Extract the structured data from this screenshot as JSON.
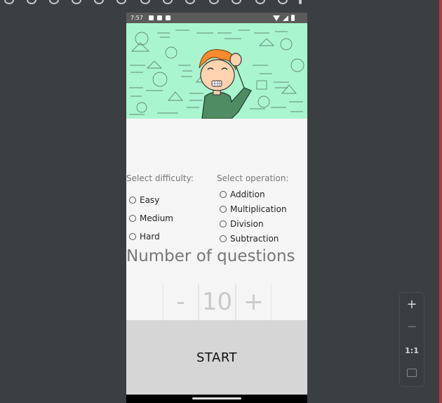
{
  "status": {
    "time": "7:57"
  },
  "difficulty": {
    "title": "Select difficulty:",
    "options": [
      "Easy",
      "Medium",
      "Hard"
    ]
  },
  "operation": {
    "title": "Select operation:",
    "options": [
      "Addition",
      "Multiplication",
      "Division",
      "Subtraction"
    ]
  },
  "questions": {
    "title": "Number of questions",
    "minus": "-",
    "count": "10",
    "plus": "+"
  },
  "start_label": "START",
  "zoom": {
    "in": "+",
    "out": "−",
    "ratio": "1:1"
  },
  "colors": {
    "banner": "#a9f5d0",
    "start_bg": "#d6d6d6",
    "toolbar": "#3c3f41"
  }
}
